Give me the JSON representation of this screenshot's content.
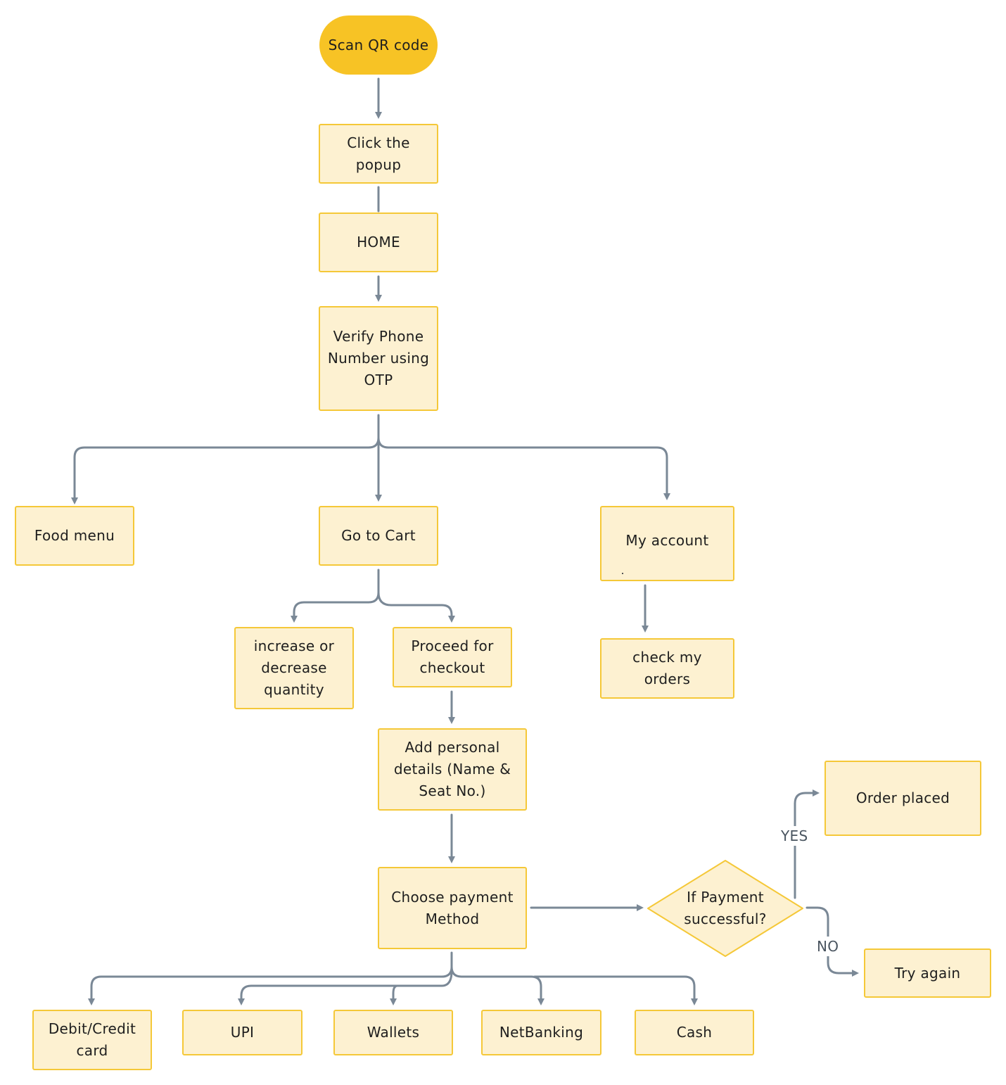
{
  "diagram": {
    "type": "flowchart",
    "colors": {
      "start_fill": "#f7c325",
      "node_fill": "#fdf1d1",
      "node_border": "#f5c838",
      "connector": "#7a8896",
      "text": "#1e1e1e"
    },
    "nodes": {
      "scan_qr": "Scan QR code",
      "click_popup": "Click the\npopup",
      "home": "HOME",
      "verify_phone": "Verify Phone\nNumber using\nOTP",
      "food_menu": "Food menu",
      "go_to_cart": "Go to Cart",
      "my_account": "My account",
      "check_orders": "check my\norders",
      "change_quantity": "increase or\ndecrease\nquantity",
      "checkout": "Proceed for\ncheckout",
      "personal_details": "Add personal\ndetails (Name &\nSeat No.)",
      "choose_payment": "Choose payment\nMethod",
      "payment_check": "If Payment\nsuccessful?",
      "order_placed": "Order placed",
      "try_again": "Try again",
      "debit_credit": "Debit/Credit\ncard",
      "upi": "UPI",
      "wallets": "Wallets",
      "netbanking": "NetBanking",
      "cash": "Cash"
    },
    "edge_labels": {
      "yes": "YES",
      "no": "NO"
    },
    "edges": [
      [
        "scan_qr",
        "click_popup"
      ],
      [
        "click_popup",
        "home"
      ],
      [
        "home",
        "verify_phone"
      ],
      [
        "verify_phone",
        "food_menu"
      ],
      [
        "verify_phone",
        "go_to_cart"
      ],
      [
        "verify_phone",
        "my_account"
      ],
      [
        "my_account",
        "check_orders"
      ],
      [
        "go_to_cart",
        "change_quantity"
      ],
      [
        "go_to_cart",
        "checkout"
      ],
      [
        "checkout",
        "personal_details"
      ],
      [
        "personal_details",
        "choose_payment"
      ],
      [
        "choose_payment",
        "payment_check"
      ],
      [
        "payment_check",
        "order_placed",
        "YES"
      ],
      [
        "payment_check",
        "try_again",
        "NO"
      ],
      [
        "choose_payment",
        "debit_credit"
      ],
      [
        "choose_payment",
        "upi"
      ],
      [
        "choose_payment",
        "wallets"
      ],
      [
        "choose_payment",
        "netbanking"
      ],
      [
        "choose_payment",
        "cash"
      ]
    ]
  }
}
